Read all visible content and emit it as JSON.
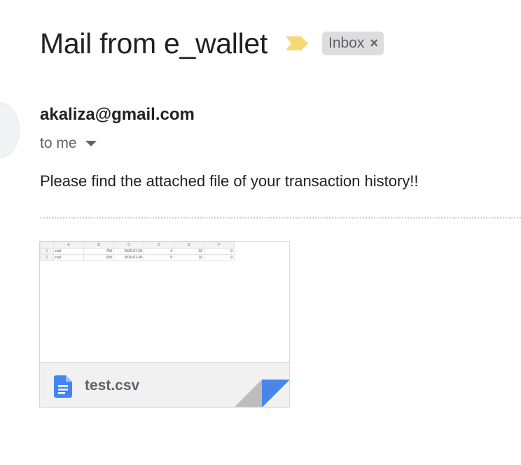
{
  "email": {
    "subject": "Mail from e_wallet",
    "label": "Inbox",
    "label_close": "×",
    "sender": "akaliza@gmail.com",
    "recipient": "to me",
    "body": "Please find the attached file of your transaction history!!"
  },
  "attachment": {
    "file_name": "test.csv",
    "icon": "google-docs-icon",
    "preview": {
      "columns": [
        "A",
        "B",
        "C",
        "D",
        "E",
        "F"
      ],
      "rows": [
        {
          "num": "1",
          "cells": [
            "null",
            "750",
            "2020-07-28",
            "4",
            "10",
            "9"
          ]
        },
        {
          "num": "2",
          "cells": [
            "null",
            "250",
            "2020-07-28",
            "5",
            "10",
            "9"
          ]
        }
      ]
    }
  },
  "colors": {
    "importance_marker": "#f8d775",
    "file_icon": "#4285f4",
    "fold_blue": "#4a86e8",
    "fold_gray": "#bdbdbd"
  }
}
